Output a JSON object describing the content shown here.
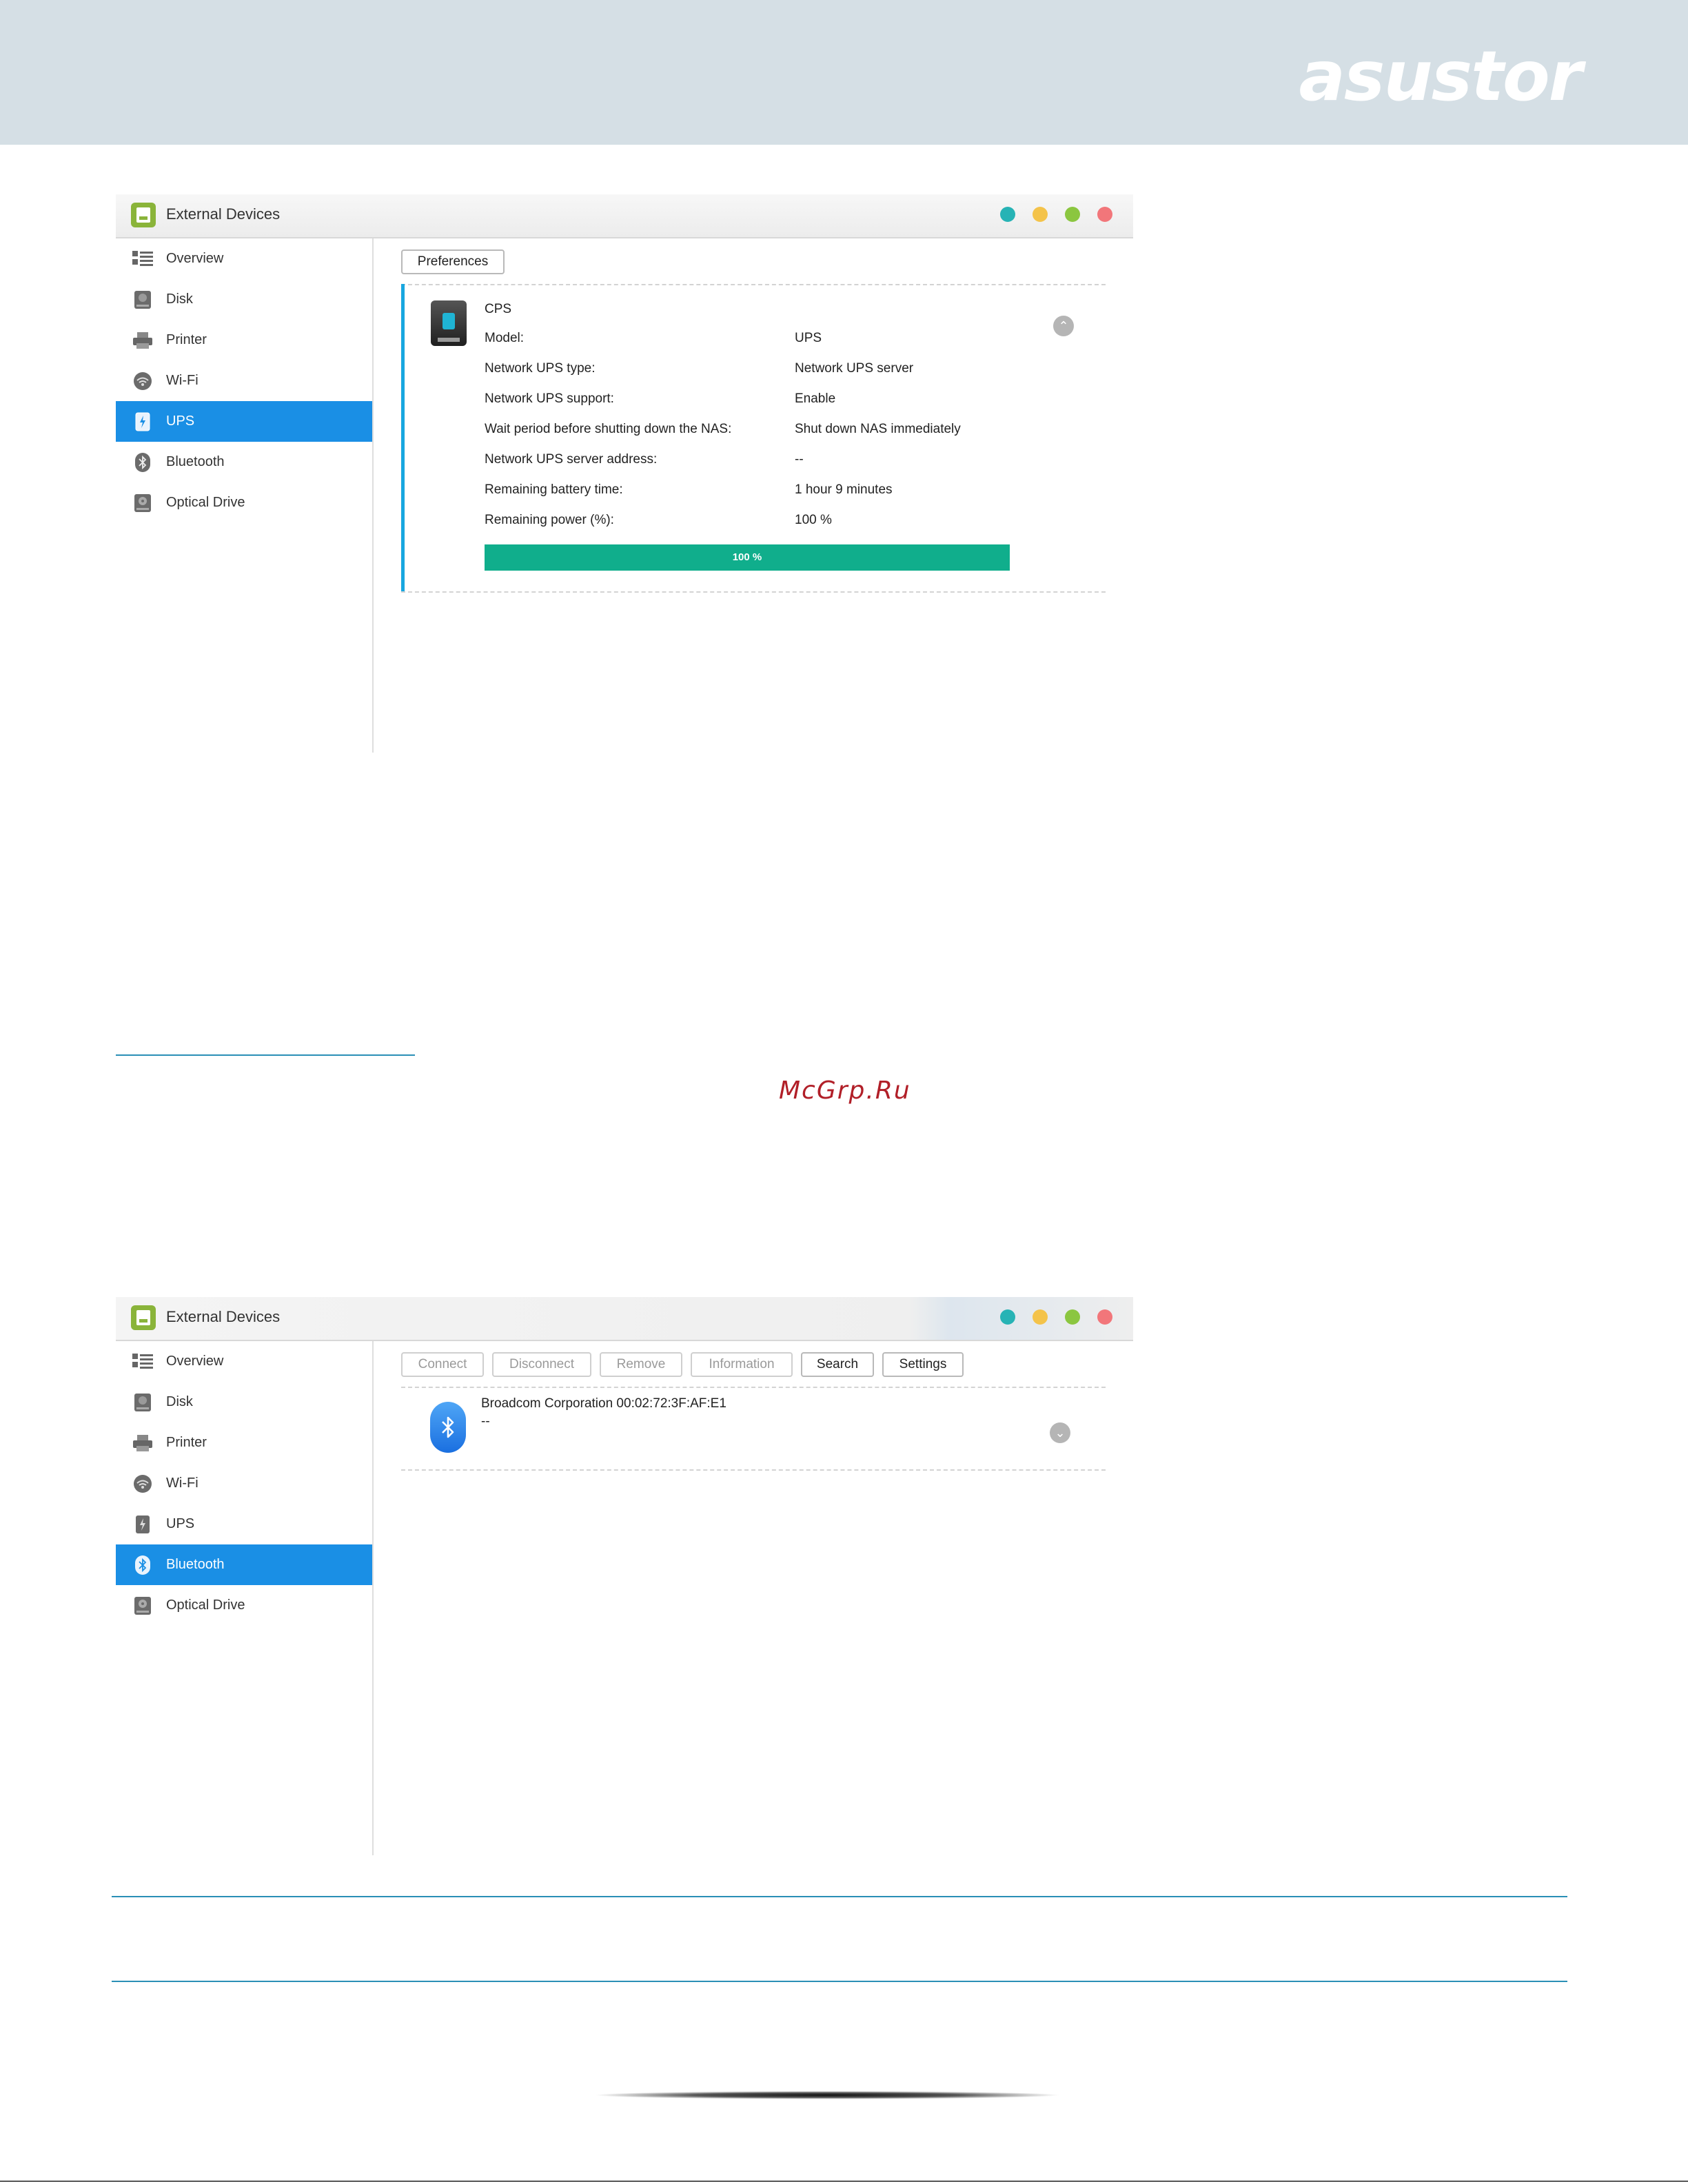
{
  "header": {
    "brand": "asustor"
  },
  "window1": {
    "title": "External Devices",
    "sidebar": [
      {
        "label": "Overview",
        "icon": "overview-icon"
      },
      {
        "label": "Disk",
        "icon": "disk-icon"
      },
      {
        "label": "Printer",
        "icon": "printer-icon"
      },
      {
        "label": "Wi-Fi",
        "icon": "wifi-icon"
      },
      {
        "label": "UPS",
        "icon": "ups-icon",
        "active": true
      },
      {
        "label": "Bluetooth",
        "icon": "bluetooth-icon"
      },
      {
        "label": "Optical Drive",
        "icon": "optical-drive-icon"
      }
    ],
    "preferences_button": "Preferences",
    "device": {
      "name": "CPS",
      "rows": [
        {
          "label": "Model:",
          "value": "UPS"
        },
        {
          "label": "Network UPS type:",
          "value": "Network UPS server"
        },
        {
          "label": "Network UPS support:",
          "value": "Enable"
        },
        {
          "label": "Wait period before shutting down the NAS:",
          "value": "Shut down NAS immediately"
        },
        {
          "label": "Network UPS server address:",
          "value": "--"
        },
        {
          "label": "Remaining battery time:",
          "value": "1 hour 9 minutes"
        },
        {
          "label": "Remaining power (%):",
          "value": "100 %"
        }
      ],
      "progress_percent": 100,
      "progress_label": "100 %"
    }
  },
  "watermark": "McGrp.Ru",
  "window2": {
    "title": "External Devices",
    "sidebar": [
      {
        "label": "Overview",
        "icon": "overview-icon"
      },
      {
        "label": "Disk",
        "icon": "disk-icon"
      },
      {
        "label": "Printer",
        "icon": "printer-icon"
      },
      {
        "label": "Wi-Fi",
        "icon": "wifi-icon"
      },
      {
        "label": "UPS",
        "icon": "ups-icon"
      },
      {
        "label": "Bluetooth",
        "icon": "bluetooth-icon",
        "active": true
      },
      {
        "label": "Optical Drive",
        "icon": "optical-drive-icon"
      }
    ],
    "toolbar": {
      "connect": "Connect",
      "disconnect": "Disconnect",
      "remove": "Remove",
      "information": "Information",
      "search": "Search",
      "settings": "Settings"
    },
    "device": {
      "name": "Broadcom Corporation 00:02:72:3F:AF:E1",
      "status": "--"
    }
  }
}
